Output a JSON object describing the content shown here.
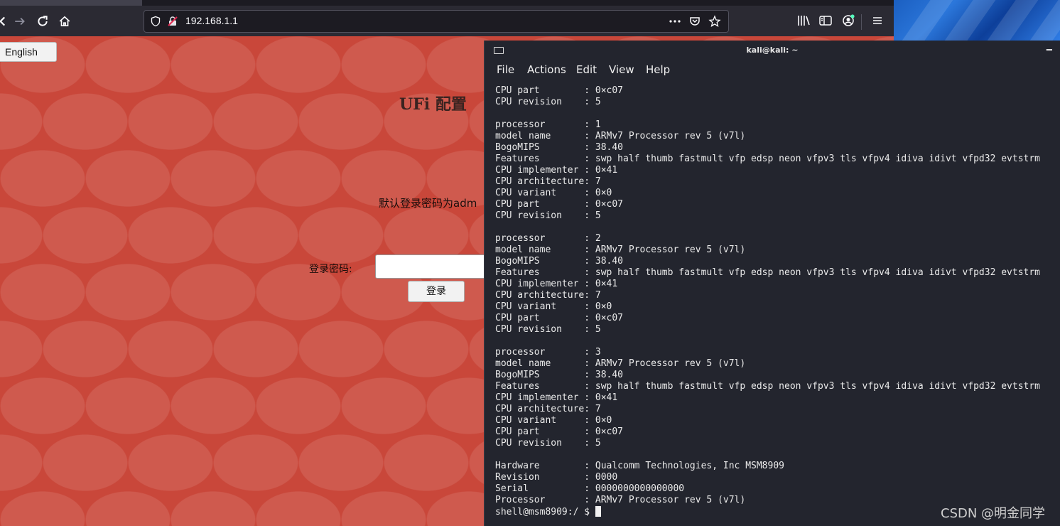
{
  "browser": {
    "url": "192.168.1.1"
  },
  "page": {
    "language_button": "English",
    "title": "UFi 配置",
    "note": "默认登录密码为adm",
    "password_label": "登录密码:",
    "login_button": "登录"
  },
  "terminal": {
    "title": "kali@kali: ~",
    "menu": [
      "File",
      "Actions",
      "Edit",
      "View",
      "Help"
    ],
    "lines": [
      "CPU part        : 0×c07",
      "CPU revision    : 5",
      "",
      "processor       : 1",
      "model name      : ARMv7 Processor rev 5 (v7l)",
      "BogoMIPS        : 38.40",
      "Features        : swp half thumb fastmult vfp edsp neon vfpv3 tls vfpv4 idiva idivt vfpd32 evtstrm",
      "CPU implementer : 0×41",
      "CPU architecture: 7",
      "CPU variant     : 0×0",
      "CPU part        : 0×c07",
      "CPU revision    : 5",
      "",
      "processor       : 2",
      "model name      : ARMv7 Processor rev 5 (v7l)",
      "BogoMIPS        : 38.40",
      "Features        : swp half thumb fastmult vfp edsp neon vfpv3 tls vfpv4 idiva idivt vfpd32 evtstrm",
      "CPU implementer : 0×41",
      "CPU architecture: 7",
      "CPU variant     : 0×0",
      "CPU part        : 0×c07",
      "CPU revision    : 5",
      "",
      "processor       : 3",
      "model name      : ARMv7 Processor rev 5 (v7l)",
      "BogoMIPS        : 38.40",
      "Features        : swp half thumb fastmult vfp edsp neon vfpv3 tls vfpv4 idiva idivt vfpd32 evtstrm",
      "CPU implementer : 0×41",
      "CPU architecture: 7",
      "CPU variant     : 0×0",
      "CPU part        : 0×c07",
      "CPU revision    : 5",
      "",
      "Hardware        : Qualcomm Technologies, Inc MSM8909",
      "Revision        : 0000",
      "Serial          : 0000000000000000",
      "Processor       : ARMv7 Processor rev 5 (v7l)"
    ],
    "prompt": "shell@msm8909:/ $ "
  },
  "watermark": "CSDN @明金同学",
  "colors": {
    "page_background": "#c9473a",
    "terminal_background": "#23252e",
    "browser_chrome": "#2b2a33"
  }
}
